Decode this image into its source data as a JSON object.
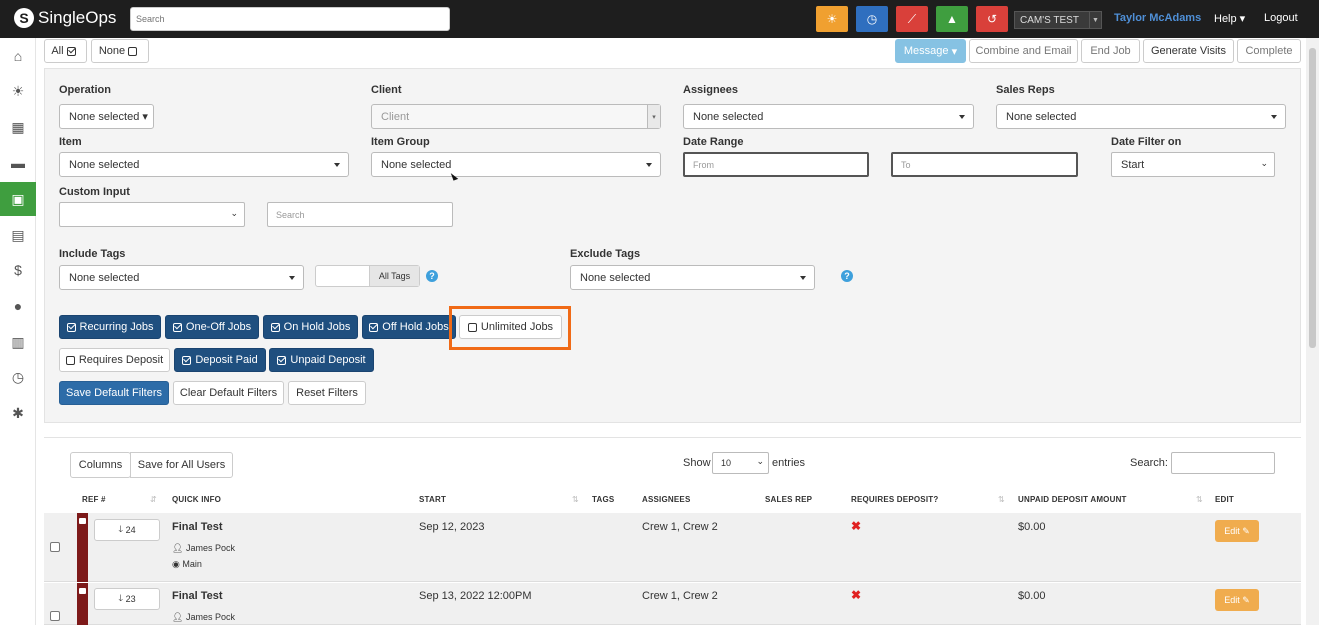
{
  "app": {
    "name": "SingleOps"
  },
  "header": {
    "search_placeholder": "Search",
    "account": "CAM'S TEST",
    "user": "Taylor McAdams",
    "help": "Help",
    "logout": "Logout",
    "quick_buttons": [
      {
        "name": "weather-button",
        "icon": "sun-icon",
        "color": "#f0a030",
        "glyph": "☀"
      },
      {
        "name": "time-button",
        "icon": "clock-icon",
        "color": "#2f6fbf",
        "glyph": "◷"
      },
      {
        "name": "activity-button",
        "icon": "chart-line-icon",
        "color": "#d9403a",
        "glyph": "⟋"
      },
      {
        "name": "training-button",
        "icon": "graduation-cap-icon",
        "color": "#3f9e3f",
        "glyph": "▲"
      },
      {
        "name": "history-button",
        "icon": "history-icon",
        "color": "#d9403a",
        "glyph": "↺"
      }
    ]
  },
  "sidebar": [
    {
      "name": "home",
      "glyph": "⌂"
    },
    {
      "name": "weather",
      "glyph": "☀"
    },
    {
      "name": "calendar",
      "glyph": "▦"
    },
    {
      "name": "truck",
      "glyph": "▬"
    },
    {
      "name": "jobs",
      "glyph": "▣",
      "active": true
    },
    {
      "name": "archive",
      "glyph": "▤"
    },
    {
      "name": "billing",
      "glyph": "$"
    },
    {
      "name": "people",
      "glyph": "●"
    },
    {
      "name": "reports",
      "glyph": "▥"
    },
    {
      "name": "time",
      "glyph": "◷"
    },
    {
      "name": "settings",
      "glyph": "✱"
    }
  ],
  "selection": {
    "all": "All",
    "none": "None"
  },
  "actions": {
    "message": "Message",
    "combine_email": "Combine and Email",
    "end_job": "End Job",
    "generate_visits": "Generate Visits",
    "complete": "Complete"
  },
  "filters": {
    "operation": {
      "label": "Operation",
      "value": "None selected"
    },
    "client": {
      "label": "Client",
      "placeholder": "Client"
    },
    "assignees": {
      "label": "Assignees",
      "value": "None selected"
    },
    "sales_reps": {
      "label": "Sales Reps",
      "value": "None selected"
    },
    "item": {
      "label": "Item",
      "value": "None selected"
    },
    "item_group": {
      "label": "Item Group",
      "value": "None selected"
    },
    "date_range": {
      "label": "Date Range",
      "from": "From",
      "to": "To"
    },
    "date_filter_on": {
      "label": "Date Filter on",
      "value": "Start"
    },
    "custom_input": {
      "label": "Custom Input",
      "value": "",
      "search_placeholder": "Search"
    },
    "include_tags": {
      "label": "Include Tags",
      "value": "None selected",
      "all_tags": "All Tags"
    },
    "exclude_tags": {
      "label": "Exclude Tags",
      "value": "None selected"
    },
    "job_types": {
      "recurring": "Recurring Jobs",
      "one_off": "One-Off Jobs",
      "on_hold": "On Hold Jobs",
      "off_hold": "Off Hold Jobs",
      "unlimited": "Unlimited Jobs"
    },
    "deposit": {
      "requires": "Requires Deposit",
      "paid": "Deposit Paid",
      "unpaid": "Unpaid Deposit"
    },
    "save_default": "Save Default Filters",
    "clear_default": "Clear Default Filters",
    "reset": "Reset Filters"
  },
  "table": {
    "columns_btn": "Columns",
    "save_all_users": "Save for All Users",
    "show_label": "Show",
    "entries_value": "10",
    "entries_label": "entries",
    "search_label": "Search:",
    "headers": {
      "ref": "REF #",
      "quick_info": "QUICK INFO",
      "start": "START",
      "tags": "TAGS",
      "assignees": "ASSIGNEES",
      "sales_rep": "SALES REP",
      "requires_deposit": "REQUIRES DEPOSIT?",
      "unpaid_amount": "UNPAID DEPOSIT AMOUNT",
      "edit": "EDIT"
    },
    "rows": [
      {
        "ref": "24",
        "title": "Final Test",
        "person": "James Pock",
        "location": "Main",
        "start": "Sep 12, 2023",
        "assignees": "Crew 1, Crew 2",
        "unpaid": "$0.00",
        "edit": "Edit"
      },
      {
        "ref": "23",
        "title": "Final Test",
        "person": "James Pock",
        "start": "Sep 13, 2022 12:00PM",
        "assignees": "Crew 1, Crew 2",
        "unpaid": "$0.00",
        "edit": "Edit"
      }
    ]
  }
}
